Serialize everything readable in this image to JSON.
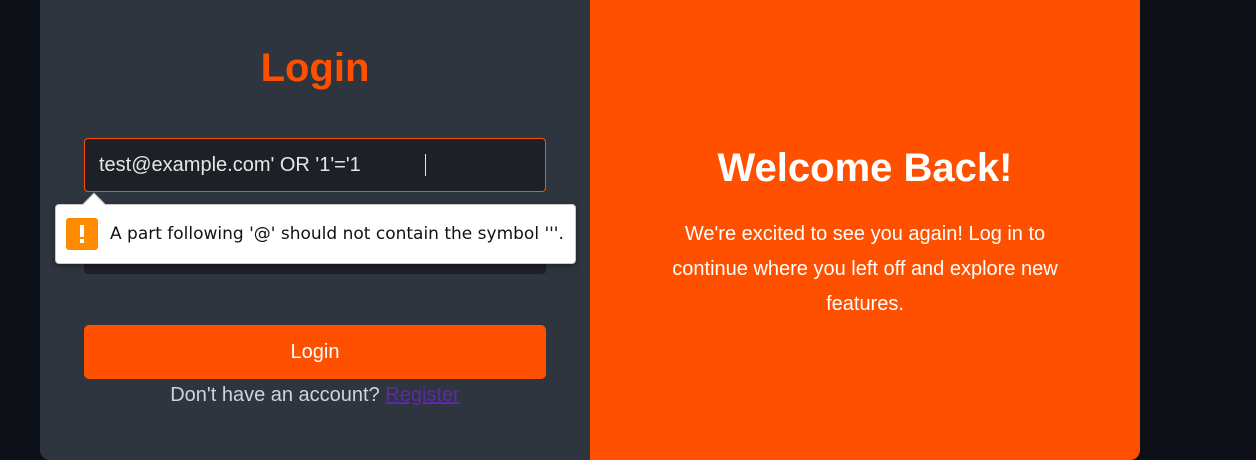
{
  "login": {
    "title": "Login",
    "email_value": "test@example.com' OR '1'='1",
    "button_label": "Login",
    "register_prompt": "Don't have an account?",
    "register_link": "Register"
  },
  "validation": {
    "message": "A part following '@' should not contain the symbol '''.",
    "icon": "warning-icon"
  },
  "welcome": {
    "title": "Welcome Back!",
    "text": "We're excited to see you again! Log in to continue where you left off and explore new features."
  },
  "colors": {
    "accent": "#ff5000",
    "panel_dark": "#2f353e",
    "input_bg": "#1d2026",
    "page_bg": "#0d1117",
    "warning": "#ff8c00",
    "link": "#5a2ca0"
  }
}
